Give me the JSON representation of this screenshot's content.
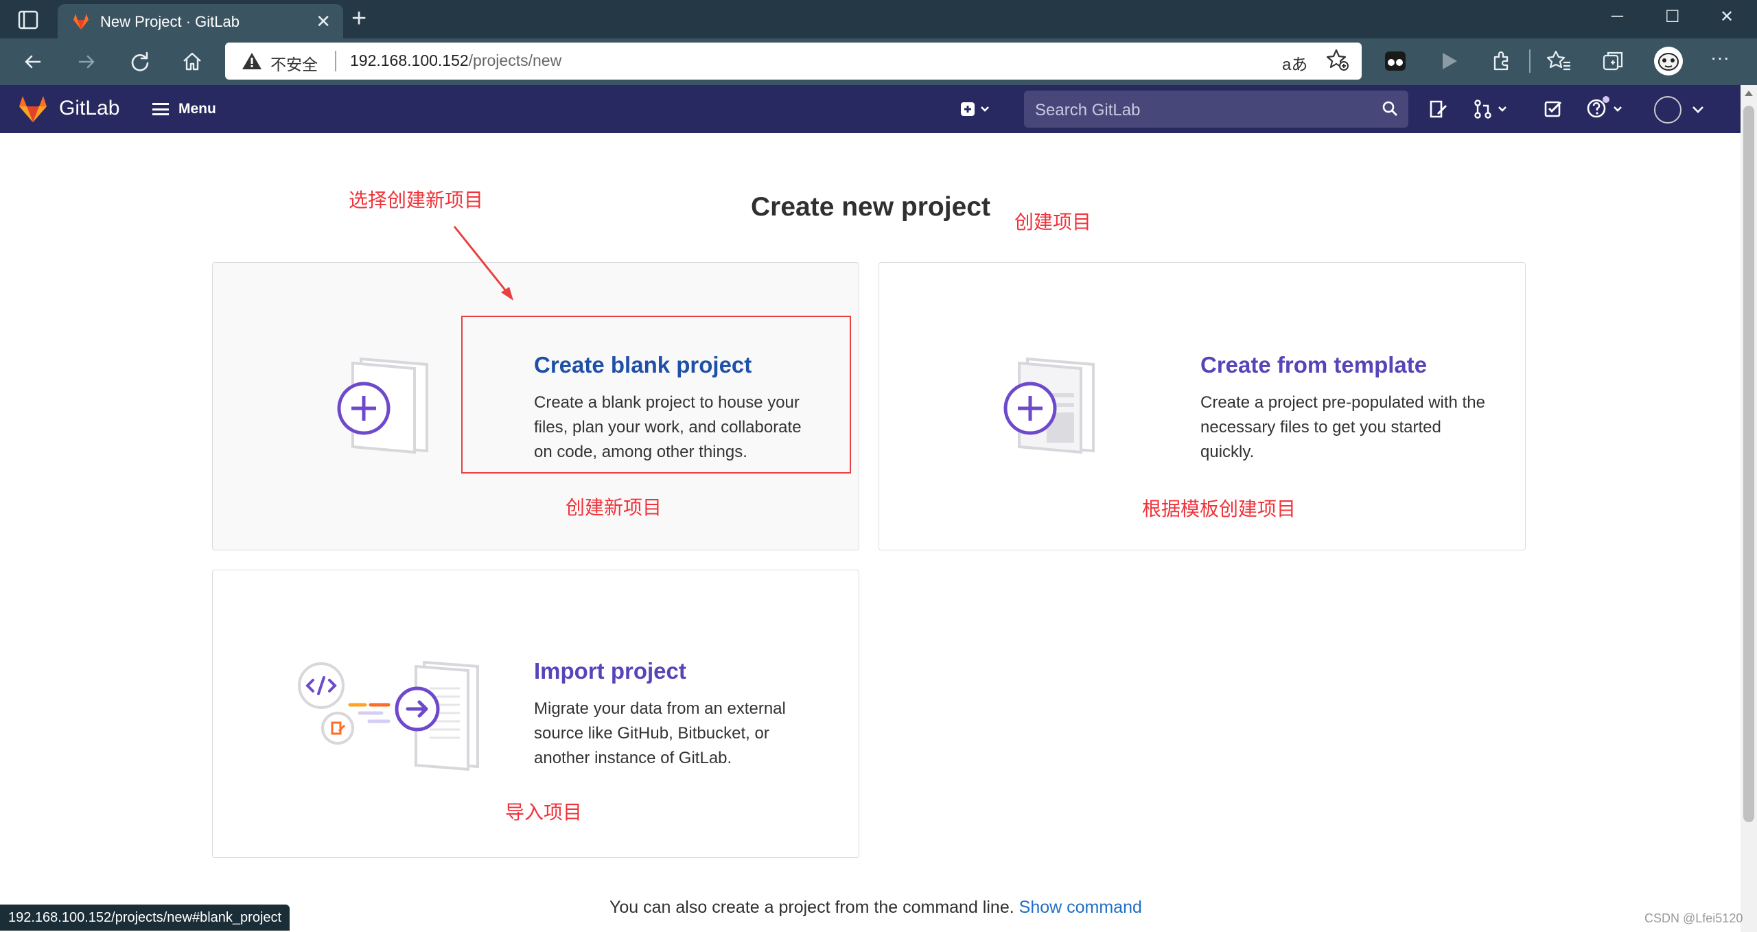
{
  "browser": {
    "tab_title": "New Project · GitLab",
    "tab_close": "✕",
    "new_tab": "+",
    "insecure_label": "不安全",
    "url_host": "192.168.100.152",
    "url_path": "/projects/new",
    "read_aloud": "aあ",
    "window_buttons": [
      "─",
      "☐",
      "✕"
    ],
    "more_label": "···"
  },
  "gitlab_header": {
    "brand": "GitLab",
    "menu_label": "Menu",
    "search_placeholder": "Search GitLab"
  },
  "page": {
    "title": "Create new project",
    "panels": [
      {
        "title": "Create blank project",
        "description": "Create a blank project to house your files, plan your work, and collaborate on code, among other things."
      },
      {
        "title": "Create from template",
        "description": "Create a project pre-populated with the necessary files to get you started quickly."
      },
      {
        "title": "Import project",
        "description": "Migrate your data from an external source like GitHub, Bitbucket, or another instance of GitLab."
      }
    ],
    "footer_text": "You can also create a project from the command line.",
    "footer_link": "Show command"
  },
  "status_bar_url": "192.168.100.152/projects/new#blank_project",
  "watermark": "CSDN @Lfei5120",
  "annotations": {
    "select_new": "选择创建新项目",
    "create_project": "创建项目",
    "create_new": "创建新项目",
    "from_template": "根据模板创建项目",
    "import": "导入项目"
  },
  "colors": {
    "gitlab_header": "#292961",
    "brand_orange": "#fc6d26",
    "link_blue": "#1f6fc5",
    "accent_purple": "#6e49cb",
    "annotation_red": "#f0333a"
  }
}
